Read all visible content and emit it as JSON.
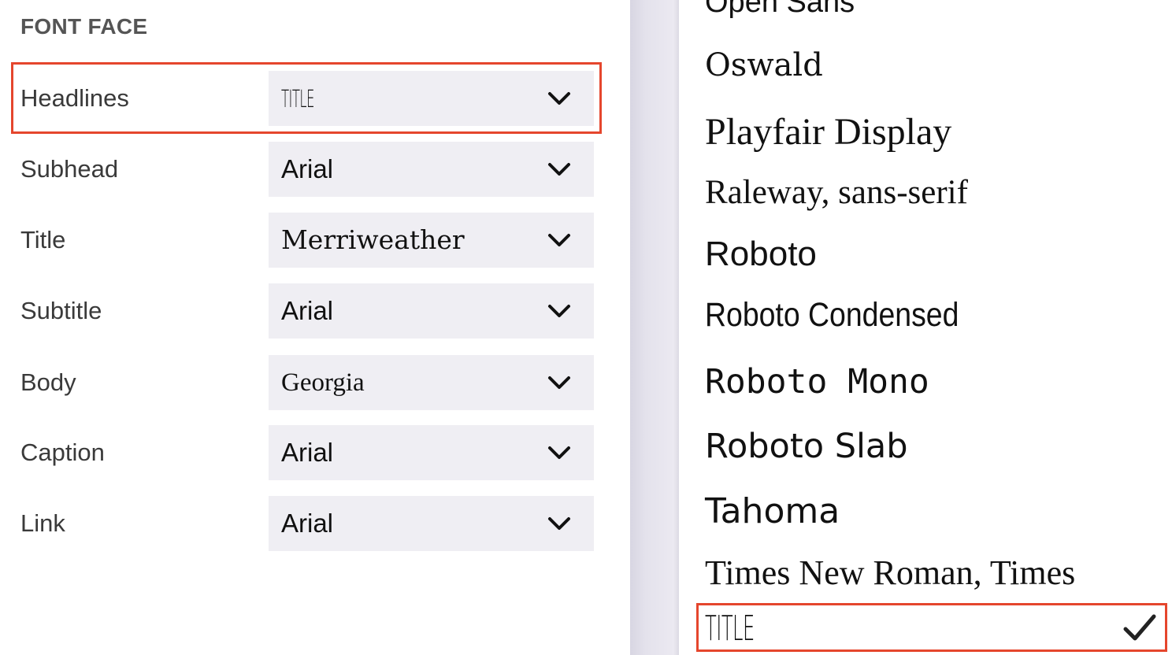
{
  "left_panel": {
    "section_title": "FONT FACE",
    "rows": [
      {
        "label": "Headlines",
        "value": "TITLE"
      },
      {
        "label": "Subhead",
        "value": "Arial"
      },
      {
        "label": "Title",
        "value": "Merriweather"
      },
      {
        "label": "Subtitle",
        "value": "Arial"
      },
      {
        "label": "Body",
        "value": "Georgia"
      },
      {
        "label": "Caption",
        "value": "Arial"
      },
      {
        "label": "Link",
        "value": "Arial"
      }
    ]
  },
  "font_list": {
    "items": [
      "Open Sans",
      "Oswald",
      "Playfair Display",
      "Raleway, sans-serif",
      "Roboto",
      "Roboto Condensed",
      "Roboto Mono",
      "Roboto Slab",
      "Tahoma",
      "Times New Roman, Times",
      "TITLE"
    ],
    "selected": "TITLE"
  },
  "colors": {
    "highlight": "#e5462d",
    "select_bg": "#efeef3"
  },
  "icons": {
    "dropdown": "chevron-down-icon",
    "selected": "checkmark-icon"
  }
}
